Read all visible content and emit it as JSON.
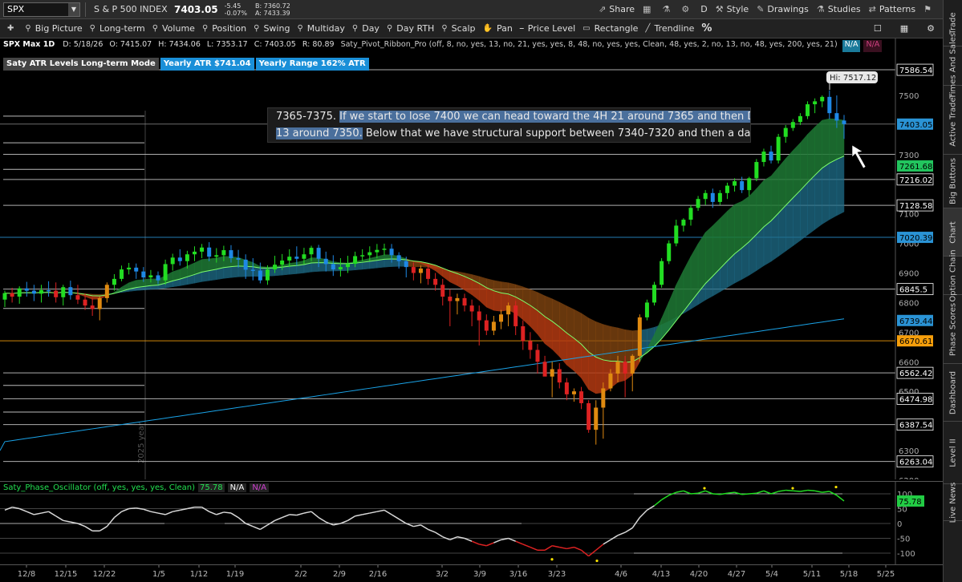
{
  "header": {
    "symbol": "SPX",
    "index_name": "S & P 500 INDEX",
    "last_price": "7403.05",
    "net_change": "-5.45",
    "pct_change": "-0.07%",
    "bid": "B: 7360.72",
    "ask": "A: 7433.39",
    "buttons": [
      {
        "icon": "share-icon",
        "glyph": "⇗",
        "label": "Share"
      },
      {
        "icon": "grid-icon",
        "glyph": "▦",
        "label": ""
      },
      {
        "icon": "flask-icon",
        "glyph": "⚗",
        "label": ""
      },
      {
        "icon": "gear-icon",
        "glyph": "⚙",
        "label": ""
      },
      {
        "icon": "",
        "glyph": "",
        "label": "D"
      },
      {
        "icon": "style-icon",
        "glyph": "⚒",
        "label": "Style"
      },
      {
        "icon": "drawings-icon",
        "glyph": "✎",
        "label": "Drawings"
      },
      {
        "icon": "studies-icon",
        "glyph": "⚗",
        "label": "Studies"
      },
      {
        "icon": "patterns-icon",
        "glyph": "⇄",
        "label": "Patterns"
      },
      {
        "icon": "flag-icon",
        "glyph": "⚑",
        "label": ""
      }
    ]
  },
  "toolbar": {
    "items": [
      {
        "icon": "pin-icon",
        "label": ""
      },
      {
        "icon": "flexible-grid-icon",
        "label": "Big Picture"
      },
      {
        "icon": "flexible-grid-icon",
        "label": "Long-term"
      },
      {
        "icon": "flexible-grid-icon",
        "label": "Volume"
      },
      {
        "icon": "flexible-grid-icon",
        "label": "Position"
      },
      {
        "icon": "flexible-grid-icon",
        "label": "Swing"
      },
      {
        "icon": "flexible-grid-icon",
        "label": "Multiday"
      },
      {
        "icon": "flexible-grid-icon",
        "label": "Day"
      },
      {
        "icon": "flexible-grid-icon",
        "label": "Day RTH"
      },
      {
        "icon": "flexible-grid-icon",
        "label": "Scalp"
      },
      {
        "icon": "hand-icon",
        "label": "Pan"
      },
      {
        "icon": "price-level-icon",
        "label": "Price Level"
      },
      {
        "icon": "rectangle-icon",
        "label": "Rectangle"
      },
      {
        "icon": "trendline-icon",
        "label": "Trendline"
      },
      {
        "icon": "percent-icon",
        "label": "%"
      }
    ]
  },
  "chart_header": {
    "title": "SPX Max 1D",
    "date": "D: 5/18/26",
    "open": "O: 7415.07",
    "high": "H: 7434.06",
    "low": "L: 7353.17",
    "close": "C: 7403.05",
    "range": "R: 80.89",
    "study": "Saty_Pivot_Ribbon_Pro (off, 8, no, yes, 13, no, 21, yes, yes, 8, 48, no, yes, yes, Clean, 48, yes, 2, no, 13, no, 48, yes, 200, yes, 21)",
    "na1": "N/A",
    "na2": "N/A"
  },
  "atr_labels": {
    "mode": "Saty ATR Levels Long-term Mode",
    "yearly_atr": "Yearly ATR $741.04",
    "yearly_range": "Yearly Range 162% ATR"
  },
  "note": {
    "line1_plain": "7365-7375. ",
    "line1_hl": "If we start to lose 7400 we can head toward the 4H 21 around 7365 and then Daily",
    "line2_hl": "13 around 7350.",
    "line2_plain": " Below that we have structural support between 7340-7320 and then a daily"
  },
  "watermark": "2025 year",
  "hi_label": "Hi: 7517.12",
  "price_axis": {
    "ticks": [
      {
        "v": 7500,
        "t": "7500"
      },
      {
        "v": 7300,
        "t": "7300"
      },
      {
        "v": 7100,
        "t": "7100"
      },
      {
        "v": 7000,
        "t": "7000"
      },
      {
        "v": 6900,
        "t": "6900"
      },
      {
        "v": 6800,
        "t": "6800"
      },
      {
        "v": 6700,
        "t": "6700"
      },
      {
        "v": 6600,
        "t": "6600"
      },
      {
        "v": 6500,
        "t": "6500"
      },
      {
        "v": 6300,
        "t": "6300"
      },
      {
        "v": 6200,
        "t": "6200"
      }
    ],
    "badges": [
      {
        "v": 7586.54,
        "t": "7586.54",
        "bg": "#000000",
        "fg": "#ffffff",
        "border": "#ffffff"
      },
      {
        "v": 7403.05,
        "t": "7403.05",
        "bg": "#2a93d5",
        "fg": "#000000",
        "border": ""
      },
      {
        "v": 7261.68,
        "t": "7261.68",
        "bg": "#22c55e",
        "fg": "#000000",
        "border": ""
      },
      {
        "v": 7216.02,
        "t": "7216.02",
        "bg": "#000000",
        "fg": "#ffffff",
        "border": "#ffffff"
      },
      {
        "v": 7128.58,
        "t": "7128.58",
        "bg": "#000000",
        "fg": "#ffffff",
        "border": "#ffffff"
      },
      {
        "v": 7020.39,
        "t": "7020.39",
        "bg": "#2a93d5",
        "fg": "#000000",
        "border": ""
      },
      {
        "v": 6845.5,
        "t": "6845.5",
        "bg": "#000000",
        "fg": "#ffffff",
        "border": "#ffffff"
      },
      {
        "v": 6739.44,
        "t": "6739.44",
        "bg": "#2a93d5",
        "fg": "#000000",
        "border": ""
      },
      {
        "v": 6670.61,
        "t": "6670.61",
        "bg": "#f59e0b",
        "fg": "#000000",
        "border": ""
      },
      {
        "v": 6562.42,
        "t": "6562.42",
        "bg": "#000000",
        "fg": "#ffffff",
        "border": "#ffffff"
      },
      {
        "v": 6474.98,
        "t": "6474.98",
        "bg": "#000000",
        "fg": "#ffffff",
        "border": "#ffffff"
      },
      {
        "v": 6387.54,
        "t": "6387.54",
        "bg": "#000000",
        "fg": "#ffffff",
        "border": "#ffffff"
      },
      {
        "v": 6263.04,
        "t": "6263.04",
        "bg": "#000000",
        "fg": "#ffffff",
        "border": "#ffffff"
      }
    ],
    "hlines": [
      {
        "v": 7586.54,
        "c": "#cccccc"
      },
      {
        "v": 7403.05,
        "c": "#888888"
      },
      {
        "v": 7301.0,
        "c": "#cccccc"
      },
      {
        "v": 7216.02,
        "c": "#cccccc"
      },
      {
        "v": 7128.58,
        "c": "#cccccc"
      },
      {
        "v": 7020.39,
        "c": "#2a93d5"
      },
      {
        "v": 6845.5,
        "c": "#cccccc"
      },
      {
        "v": 6670.61,
        "c": "#f59e0b"
      },
      {
        "v": 6562.42,
        "c": "#cccccc"
      },
      {
        "v": 6474.98,
        "c": "#cccccc"
      },
      {
        "v": 6387.54,
        "c": "#cccccc"
      },
      {
        "v": 6263.04,
        "c": "#cccccc"
      }
    ]
  },
  "oscillator": {
    "title": "Saty_Phase_Oscillator (off, yes, yes, yes, Clean)",
    "value": "75.78",
    "na1": "N/A",
    "na2": "N/A",
    "ticks": [
      {
        "v": 100,
        "t": "100"
      },
      {
        "v": 50,
        "t": "50"
      },
      {
        "v": 0,
        "t": "0"
      },
      {
        "v": -50,
        "t": "-50"
      },
      {
        "v": -100,
        "t": "-100"
      }
    ]
  },
  "x_axis": {
    "labels": [
      "12/8",
      "12/15",
      "12/22",
      "1/5",
      "1/12",
      "1/19",
      "2/2",
      "2/9",
      "2/16",
      "3/2",
      "3/9",
      "3/16",
      "3/23",
      "4/6",
      "4/13",
      "4/20",
      "4/27",
      "5/4",
      "5/11",
      "5/18",
      "5/25"
    ]
  },
  "side_tabs": [
    "Trade",
    "Times And Sales",
    "Active Trader",
    "Big Buttons",
    "Chart",
    "Option Chain",
    "Phase Scores",
    "Dashboard",
    "Level II",
    "Live News"
  ],
  "chart_data": {
    "type": "candlestick",
    "title": "SPX Max 1D",
    "x": [
      "12/1",
      "12/2",
      "12/3",
      "12/4",
      "12/5",
      "12/8",
      "12/9",
      "12/10",
      "12/11",
      "12/12",
      "12/15",
      "12/16",
      "12/17",
      "12/18",
      "12/19",
      "12/22",
      "12/23",
      "12/24",
      "12/26",
      "12/29",
      "12/30",
      "12/31",
      "1/2",
      "1/5",
      "1/6",
      "1/7",
      "1/8",
      "1/9",
      "1/12",
      "1/13",
      "1/14",
      "1/15",
      "1/16",
      "1/20",
      "1/21",
      "1/22",
      "1/23",
      "1/26",
      "1/27",
      "1/28",
      "1/29",
      "1/30",
      "2/2",
      "2/3",
      "2/4",
      "2/5",
      "2/6",
      "2/9",
      "2/10",
      "2/11",
      "2/12",
      "2/13",
      "2/17",
      "2/18",
      "2/19",
      "2/20",
      "2/23",
      "2/24",
      "2/25",
      "2/26",
      "2/27",
      "3/2",
      "3/3",
      "3/4",
      "3/5",
      "3/6",
      "3/9",
      "3/10",
      "3/11",
      "3/12",
      "3/13",
      "3/16",
      "3/17",
      "3/18",
      "3/19",
      "3/20",
      "3/23",
      "3/24",
      "3/25",
      "3/26",
      "3/27",
      "3/30",
      "3/31",
      "4/1",
      "4/2",
      "4/6",
      "4/7",
      "4/8",
      "4/9",
      "4/10",
      "4/13",
      "4/14",
      "4/15",
      "4/16",
      "4/17",
      "4/20",
      "4/21",
      "4/22",
      "4/23",
      "4/24",
      "4/27",
      "4/28",
      "4/29",
      "4/30",
      "5/1",
      "5/4",
      "5/5",
      "5/6",
      "5/7",
      "5/8",
      "5/11",
      "5/12",
      "5/13",
      "5/14",
      "5/15",
      "5/18"
    ],
    "open": [
      6810,
      6832,
      6820,
      6848,
      6840,
      6830,
      6842,
      6840,
      6818,
      6852,
      6825,
      6810,
      6790,
      6778,
      6815,
      6860,
      6880,
      6912,
      6918,
      6905,
      6885,
      6892,
      6875,
      6930,
      6952,
      6940,
      6963,
      6972,
      6986,
      6955,
      6960,
      6977,
      6950,
      6945,
      6911,
      6908,
      6875,
      6912,
      6928,
      6942,
      6955,
      6948,
      6963,
      6985,
      6948,
      6930,
      6912,
      6920,
      6931,
      6957,
      6960,
      6970,
      6978,
      6982,
      6960,
      6940,
      6920,
      6900,
      6915,
      6880,
      6860,
      6820,
      6805,
      6815,
      6790,
      6770,
      6740,
      6705,
      6735,
      6760,
      6790,
      6720,
      6670,
      6640,
      6600,
      6550,
      6575,
      6530,
      6490,
      6500,
      6460,
      6370,
      6445,
      6510,
      6560,
      6600,
      6560,
      6620,
      6750,
      6800,
      6860,
      6940,
      7000,
      7060,
      7080,
      7120,
      7150,
      7170,
      7140,
      7170,
      7195,
      7210,
      7180,
      7220,
      7275,
      7310,
      7280,
      7360,
      7390,
      7410,
      7430,
      7470,
      7480,
      7495,
      7440,
      7415
    ],
    "high": [
      6840,
      6850,
      6855,
      6870,
      6860,
      6860,
      6872,
      6868,
      6860,
      6874,
      6860,
      6830,
      6815,
      6820,
      6868,
      6896,
      6925,
      6934,
      6932,
      6920,
      6910,
      6905,
      6945,
      6965,
      6980,
      6975,
      6990,
      6998,
      7004,
      6984,
      6992,
      6994,
      6978,
      6963,
      6950,
      6935,
      6926,
      6958,
      6964,
      6980,
      6990,
      6985,
      6992,
      6995,
      6972,
      6960,
      6950,
      6958,
      6972,
      6980,
      6990,
      6998,
      6999,
      6998,
      6970,
      6955,
      6935,
      6925,
      6930,
      6900,
      6880,
      6845,
      6830,
      6830,
      6810,
      6790,
      6760,
      6755,
      6775,
      6800,
      6805,
      6740,
      6700,
      6660,
      6620,
      6600,
      6595,
      6545,
      6510,
      6515,
      6470,
      6470,
      6530,
      6575,
      6620,
      6620,
      6625,
      6760,
      6810,
      6870,
      6950,
      7010,
      7080,
      7085,
      7130,
      7160,
      7180,
      7185,
      7180,
      7205,
      7220,
      7225,
      7225,
      7285,
      7320,
      7330,
      7370,
      7400,
      7420,
      7440,
      7480,
      7490,
      7500,
      7517.12,
      7500,
      7434.06
    ],
    "low": [
      6785,
      6800,
      6796,
      6820,
      6805,
      6800,
      6820,
      6800,
      6790,
      6810,
      6795,
      6775,
      6755,
      6740,
      6800,
      6840,
      6872,
      6895,
      6880,
      6870,
      6868,
      6862,
      6860,
      6908,
      6925,
      6915,
      6940,
      6950,
      6940,
      6935,
      6940,
      6935,
      6918,
      6880,
      6875,
      6865,
      6860,
      6900,
      6910,
      6920,
      6925,
      6930,
      6940,
      6920,
      6905,
      6890,
      6888,
      6900,
      6920,
      6940,
      6940,
      6950,
      6960,
      6935,
      6915,
      6885,
      6875,
      6865,
      6860,
      6840,
      6790,
      6720,
      6760,
      6770,
      6720,
      6655,
      6690,
      6690,
      6710,
      6720,
      6690,
      6640,
      6610,
      6560,
      6560,
      6480,
      6510,
      6470,
      6465,
      6440,
      6360,
      6320,
      6340,
      6500,
      6530,
      6480,
      6500,
      6600,
      6740,
      6790,
      6850,
      6930,
      6990,
      7040,
      7060,
      7110,
      7130,
      7120,
      7130,
      7150,
      7175,
      7170,
      7160,
      7210,
      7260,
      7270,
      7270,
      7340,
      7380,
      7400,
      7420,
      7440,
      7460,
      7420,
      7390,
      7353.17
    ],
    "close": [
      6832,
      6820,
      6848,
      6840,
      6830,
      6842,
      6840,
      6818,
      6852,
      6825,
      6810,
      6790,
      6778,
      6815,
      6860,
      6880,
      6912,
      6918,
      6905,
      6885,
      6892,
      6875,
      6930,
      6952,
      6940,
      6963,
      6972,
      6986,
      6955,
      6960,
      6977,
      6950,
      6945,
      6911,
      6908,
      6875,
      6912,
      6928,
      6942,
      6955,
      6948,
      6963,
      6985,
      6948,
      6930,
      6912,
      6920,
      6931,
      6957,
      6960,
      6970,
      6978,
      6982,
      6960,
      6940,
      6920,
      6900,
      6915,
      6880,
      6860,
      6820,
      6805,
      6815,
      6790,
      6770,
      6740,
      6705,
      6735,
      6760,
      6790,
      6720,
      6670,
      6640,
      6600,
      6550,
      6575,
      6530,
      6490,
      6500,
      6460,
      6370,
      6445,
      6510,
      6560,
      6600,
      6560,
      6620,
      6750,
      6800,
      6860,
      6940,
      7000,
      7060,
      7080,
      7120,
      7150,
      7170,
      7140,
      7170,
      7195,
      7210,
      7180,
      7220,
      7275,
      7310,
      7280,
      7360,
      7390,
      7410,
      7430,
      7470,
      7480,
      7495,
      7440,
      7415,
      7403.05
    ],
    "ylim": [
      6200,
      7620
    ],
    "oscillator": [
      45,
      55,
      50,
      40,
      30,
      35,
      40,
      25,
      10,
      5,
      0,
      -10,
      -25,
      -25,
      -10,
      20,
      40,
      50,
      52,
      48,
      40,
      35,
      30,
      40,
      45,
      50,
      55,
      55,
      40,
      30,
      38,
      35,
      20,
      0,
      -10,
      -20,
      -5,
      10,
      20,
      30,
      28,
      35,
      40,
      20,
      5,
      -5,
      0,
      10,
      25,
      30,
      35,
      40,
      45,
      30,
      15,
      0,
      -10,
      -5,
      -20,
      -30,
      -45,
      -55,
      -45,
      -50,
      -60,
      -70,
      -75,
      -65,
      -55,
      -50,
      -60,
      -70,
      -80,
      -90,
      -90,
      -75,
      -80,
      -85,
      -80,
      -90,
      -110,
      -90,
      -70,
      -55,
      -40,
      -30,
      -15,
      20,
      45,
      60,
      80,
      95,
      105,
      110,
      100,
      102,
      110,
      100,
      98,
      102,
      105,
      98,
      100,
      102,
      110,
      100,
      108,
      112,
      110,
      108,
      112,
      110,
      105,
      108,
      95,
      75.78
    ]
  }
}
